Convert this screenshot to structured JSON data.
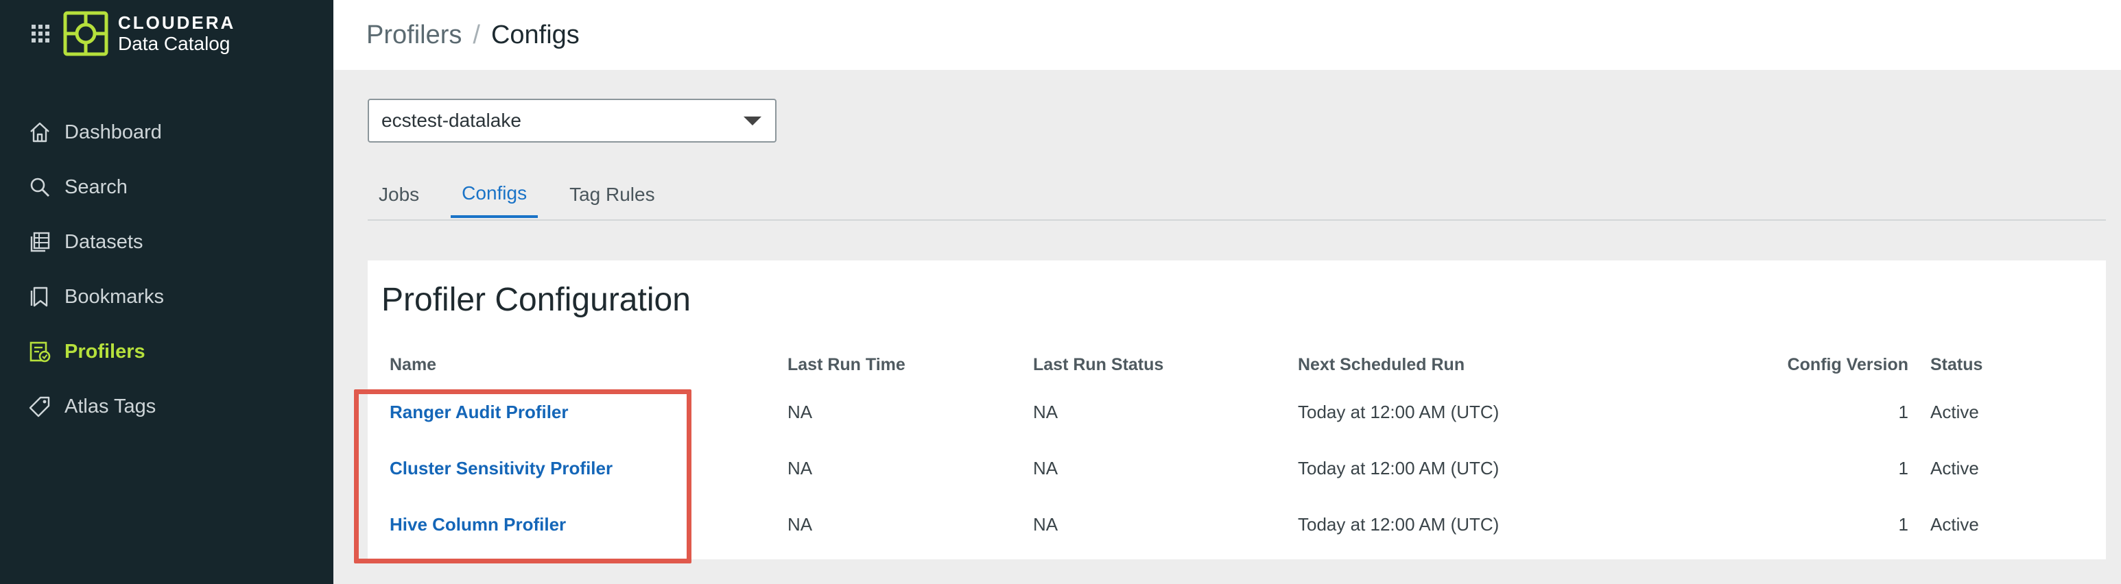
{
  "brand": {
    "name": "CLOUDERA",
    "product": "Data Catalog",
    "accent_color": "#b6e03c"
  },
  "sidebar": {
    "items": [
      {
        "label": "Dashboard",
        "icon": "home-icon",
        "active": false
      },
      {
        "label": "Search",
        "icon": "search-icon",
        "active": false
      },
      {
        "label": "Datasets",
        "icon": "datasets-icon",
        "active": false
      },
      {
        "label": "Bookmarks",
        "icon": "bookmark-icon",
        "active": false
      },
      {
        "label": "Profilers",
        "icon": "profilers-icon",
        "active": true
      },
      {
        "label": "Atlas Tags",
        "icon": "tag-icon",
        "active": false
      }
    ]
  },
  "breadcrumb": {
    "parent": "Profilers",
    "separator": "/",
    "current": "Configs"
  },
  "datalake_select": {
    "value": "ecstest-datalake"
  },
  "tabs": [
    {
      "label": "Jobs",
      "active": false
    },
    {
      "label": "Configs",
      "active": true
    },
    {
      "label": "Tag Rules",
      "active": false
    }
  ],
  "config_card": {
    "title": "Profiler Configuration",
    "columns": [
      "Name",
      "Last Run Time",
      "Last Run Status",
      "Next Scheduled Run",
      "Config Version",
      "Status"
    ],
    "rows": [
      {
        "name": "Ranger Audit Profiler",
        "last_run_time": "NA",
        "last_run_status": "NA",
        "next_run": "Today at 12:00 AM (UTC)",
        "version": "1",
        "status": "Active"
      },
      {
        "name": "Cluster Sensitivity Profiler",
        "last_run_time": "NA",
        "last_run_status": "NA",
        "next_run": "Today at 12:00 AM (UTC)",
        "version": "1",
        "status": "Active"
      },
      {
        "name": "Hive Column Profiler",
        "last_run_time": "NA",
        "last_run_status": "NA",
        "next_run": "Today at 12:00 AM (UTC)",
        "version": "1",
        "status": "Active"
      }
    ]
  },
  "colors": {
    "sidebar_bg": "#16262c",
    "link": "#1466b8",
    "tab_active": "#1a73c7",
    "highlight": "#e0594c"
  }
}
